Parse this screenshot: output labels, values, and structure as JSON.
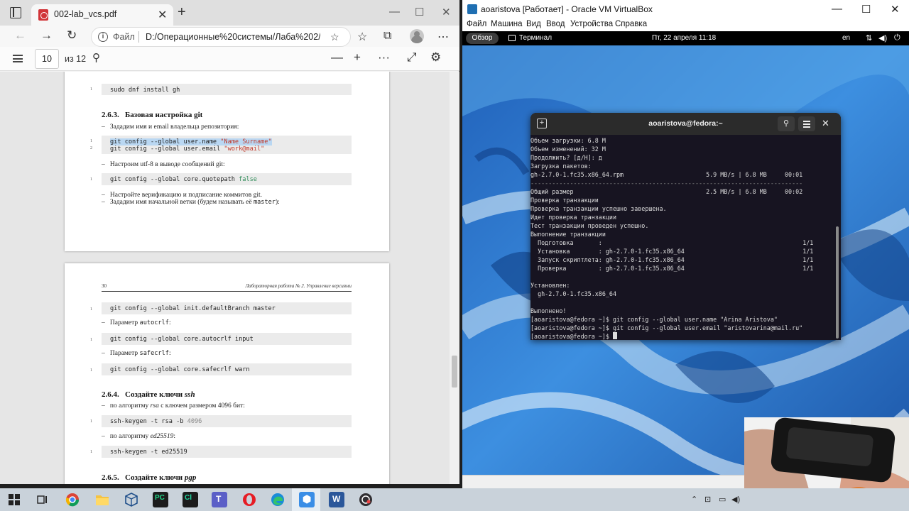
{
  "edge": {
    "tab_title": "002-lab_vcs.pdf",
    "tab_close": "✕",
    "new_tab": "+",
    "file_label": "Файл",
    "url": "D:/Операционные%20системы/Лаба%202/0...",
    "page_number": "10",
    "page_total": "из 12",
    "zoom_minus": "—",
    "zoom_plus": "+",
    "more": "···"
  },
  "pdf": {
    "page1": {
      "code_install": "sudo dnf install gh",
      "section_num": "2.6.3.",
      "section_title": "Базовая настройка git",
      "item_name_email": "Зададим имя и email владельца репозитория:",
      "code_user_name_cmd": "git config --global user.name ",
      "code_user_name_val": "\"Name Surname\"",
      "code_user_email_cmd": "git config --global user.email ",
      "code_user_email_val": "\"work@mail\"",
      "item_utf8": "Настроим utf-8 в выводе сообщений git:",
      "code_quotepath_cmd": "git config --global core.quotepath ",
      "code_quotepath_val": "false",
      "item_verify": "Настройте верификацию и подписание коммитов git.",
      "item_branch": "Зададим имя начальной ветки (будем называть её ",
      "item_branch_code": "master",
      "item_branch_end": "):"
    },
    "page2": {
      "header_left": "30",
      "header_right": "Лабораторная работа № 2. Управление версиями",
      "code_default_branch": "git config --global init.defaultBranch master",
      "item_autocrlf": "Параметр ",
      "item_autocrlf_code": "autocrlf",
      "item_autocrlf_end": ":",
      "code_autocrlf": "git config --global core.autocrlf input",
      "item_safecrlf": "Параметр ",
      "item_safecrlf_code": "safecrlf",
      "item_safecrlf_end": ":",
      "code_safecrlf": "git config --global core.safecrlf warn",
      "section_num_ssh": "2.6.4.",
      "section_title_ssh": "Создайте ключи ",
      "section_title_ssh_em": "ssh",
      "item_rsa": "по алгоритму ",
      "item_rsa_em": "rsa",
      "item_rsa_end": " с ключем размером 4096 бит:",
      "code_rsa_cmd": "ssh-keygen -t rsa -b ",
      "code_rsa_val": "4096",
      "item_ed": "по алгоритму ",
      "item_ed_em": "ed25519",
      "item_ed_end": ":",
      "code_ed": "ssh-keygen -t ed25519",
      "section_num_pgp": "2.6.5.",
      "section_title_pgp": "Создайте ключи ",
      "section_title_pgp_em": "pgp"
    }
  },
  "vbox": {
    "title": "aoaristova [Работает] - Oracle VM VirtualBox",
    "menu": [
      "Файл",
      "Машина",
      "Вид",
      "Ввод",
      "Устройства",
      "Справка"
    ]
  },
  "gnome": {
    "overview": "Обзор",
    "app_name": "Терминал",
    "clock": "Пт, 22 апреля  11:18",
    "keyboard_layout": "en"
  },
  "terminal": {
    "title": "aoaristova@fedora:~",
    "lines": [
      "Объем загрузки: 6.8 M",
      "Объем изменений: 32 M",
      "Продолжить? [д/Н]: д",
      "Загрузка пакетов:",
      "gh-2.7.0-1.fc35.x86_64.rpm                       5.9 MB/s | 6.8 MB     00:01",
      "---",
      "Общий размер                                     2.5 MB/s | 6.8 MB     00:02",
      "Проверка транзакции",
      "Проверка транзакции успешно завершена.",
      "Идет проверка транзакции",
      "Тест транзакции проведен успешно.",
      "Выполнение транзакции",
      "  Подготовка       :                                                        1/1",
      "  Установка        : gh-2.7.0-1.fc35.x86_64                                 1/1",
      "  Запуск скриптлета: gh-2.7.0-1.fc35.x86_64                                 1/1",
      "  Проверка         : gh-2.7.0-1.fc35.x86_64                                 1/1",
      "",
      "Установлен:",
      "  gh-2.7.0-1.fc35.x86_64",
      "",
      "Выполнено!",
      "[aoaristova@fedora ~]$ git config --global user.name \"Arina Aristova\"",
      "[aoaristova@fedora ~]$ git config --global user.email \"aristovarina@mail.ru\"",
      "[aoaristova@fedora ~]$ "
    ]
  },
  "colors": {
    "terminal_bg": "#171421",
    "pdf_highlight": "#b9d7f2",
    "code_string": "#c0392b",
    "code_keyword": "#2e8b57"
  }
}
